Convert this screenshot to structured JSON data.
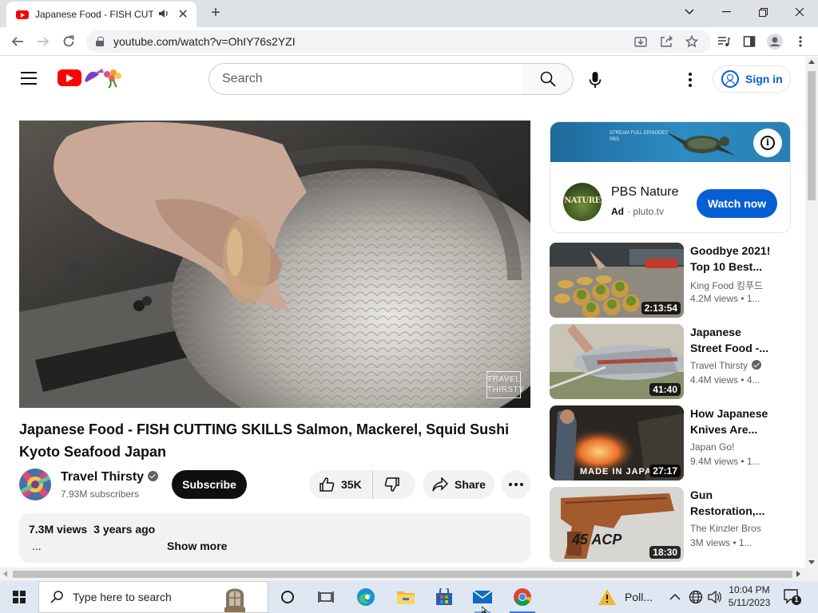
{
  "browser": {
    "tab_title": "Japanese Food - FISH CUTTI",
    "url": "youtube.com/watch?v=OhIY76s2YZI"
  },
  "youtube": {
    "search_placeholder": "Search",
    "sign_in_label": "Sign in",
    "accent_color": "#ff0000",
    "link_color": "#065fd4"
  },
  "video": {
    "title": "Japanese Food - FISH CUTTING SKILLS Salmon, Mackerel, Squid Sushi Kyoto Seafood Japan",
    "watermark": "TRAVEL THIRSTY",
    "channel_name": "Travel Thirsty",
    "subscribers": "7.93M subscribers",
    "subscribe_label": "Subscribe",
    "like_count": "35K",
    "share_label": "Share",
    "views": "7.3M views",
    "age": "3 years ago",
    "desc_ellipsis": "...",
    "show_more_label": "Show more"
  },
  "ad": {
    "banner_text": "STREAM FULL EPISODES",
    "banner_brand": "PBS",
    "logo_text": "NATURE",
    "title": "PBS Nature",
    "ad_label": "Ad",
    "domain": "· pluto.tv",
    "cta_label": "Watch now"
  },
  "recommendations": [
    {
      "title": "Goodbye 2021! Top 10 Best...",
      "channel": "King Food 킹푸드",
      "meta": "4.2M views  • 1...",
      "duration": "2:13:54",
      "verified": false
    },
    {
      "title": "Japanese Street Food -...",
      "channel": "Travel Thirsty",
      "meta": "4.4M views  • 4...",
      "duration": "41:40",
      "verified": true,
      "thumb_text": ""
    },
    {
      "title": "How Japanese Knives Are...",
      "channel": "Japan Go!",
      "meta": "9.4M views  • 1...",
      "duration": "27:17",
      "verified": false,
      "thumb_text": "MADE IN JAPA"
    },
    {
      "title": "Gun Restoration,...",
      "channel": "The Kinzler Bros",
      "meta": "3M views  • 1...",
      "duration": "18:30",
      "verified": false,
      "thumb_text": "45 ACP"
    }
  ],
  "taskbar": {
    "search_placeholder": "Type here to search",
    "weather_label": "Poll...",
    "time": "10:04 PM",
    "date": "5/11/2023",
    "notification_count": "1"
  },
  "icons": {
    "tab": [
      "youtube-favicon",
      "audio-icon",
      "close-tab-icon",
      "new-tab-icon"
    ],
    "window": [
      "tab-search-chevron-icon",
      "minimize-icon",
      "restore-icon",
      "close-window-icon"
    ],
    "toolbar": [
      "back-icon",
      "forward-icon",
      "reload-icon",
      "lock-icon",
      "install-icon",
      "share-page-icon",
      "bookmark-star-icon",
      "media-controls-icon",
      "side-panel-icon",
      "profile-icon",
      "chrome-menu-icon"
    ]
  }
}
